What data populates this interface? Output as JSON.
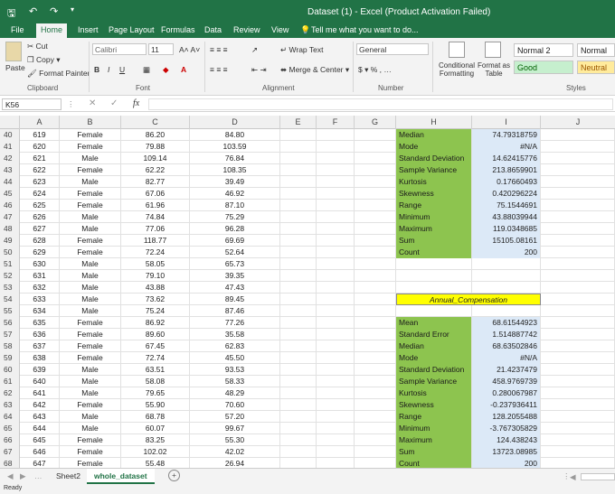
{
  "window": {
    "title": "Dataset (1) - Excel (Product Activation Failed)"
  },
  "tabs": [
    "File",
    "Home",
    "Insert",
    "Page Layout",
    "Formulas",
    "Data",
    "Review",
    "View"
  ],
  "tell_me": "Tell me what you want to do...",
  "clipboard": {
    "paste": "Paste",
    "cut": "Cut",
    "copy": "Copy",
    "format_painter": "Format Painter",
    "label": "Clipboard"
  },
  "font": {
    "name": "Calibri",
    "size": "11",
    "label": "Font"
  },
  "alignment": {
    "wrap": "Wrap Text",
    "merge": "Merge & Center",
    "label": "Alignment"
  },
  "number": {
    "format": "General",
    "label": "Number"
  },
  "styles": {
    "conditional": "Conditional Formatting",
    "format_table": "Format as Table",
    "normal2": "Normal 2",
    "normal": "Normal",
    "good": "Good",
    "neutral": "Neutral",
    "label": "Styles"
  },
  "formula_bar": {
    "namebox": "K56"
  },
  "columns": [
    "A",
    "B",
    "C",
    "D",
    "E",
    "F",
    "G",
    "H",
    "I",
    "J"
  ],
  "rows": [
    {
      "n": "40",
      "a": "619",
      "b": "Female",
      "c": "86.20",
      "d": "84.80",
      "h": "Median",
      "i": "74.79318759"
    },
    {
      "n": "41",
      "a": "620",
      "b": "Female",
      "c": "79.88",
      "d": "103.59",
      "h": "Mode",
      "i": "#N/A"
    },
    {
      "n": "42",
      "a": "621",
      "b": "Male",
      "c": "109.14",
      "d": "76.84",
      "h": "Standard Deviation",
      "i": "14.62415776"
    },
    {
      "n": "43",
      "a": "622",
      "b": "Female",
      "c": "62.22",
      "d": "108.35",
      "h": "Sample Variance",
      "i": "213.8659901"
    },
    {
      "n": "44",
      "a": "623",
      "b": "Male",
      "c": "82.77",
      "d": "39.49",
      "h": "Kurtosis",
      "i": "0.17660493"
    },
    {
      "n": "45",
      "a": "624",
      "b": "Female",
      "c": "67.06",
      "d": "46.92",
      "h": "Skewness",
      "i": "0.420296224"
    },
    {
      "n": "46",
      "a": "625",
      "b": "Female",
      "c": "61.96",
      "d": "87.10",
      "h": "Range",
      "i": "75.1544691"
    },
    {
      "n": "47",
      "a": "626",
      "b": "Male",
      "c": "74.84",
      "d": "75.29",
      "h": "Minimum",
      "i": "43.88039944"
    },
    {
      "n": "48",
      "a": "627",
      "b": "Male",
      "c": "77.06",
      "d": "96.28",
      "h": "Maximum",
      "i": "119.0348685"
    },
    {
      "n": "49",
      "a": "628",
      "b": "Female",
      "c": "118.77",
      "d": "69.69",
      "h": "Sum",
      "i": "15105.08161"
    },
    {
      "n": "50",
      "a": "629",
      "b": "Female",
      "c": "72.24",
      "d": "52.64",
      "h": "Count",
      "i": "200"
    },
    {
      "n": "51",
      "a": "630",
      "b": "Male",
      "c": "58.05",
      "d": "65.73",
      "h": "",
      "i": ""
    },
    {
      "n": "52",
      "a": "631",
      "b": "Male",
      "c": "79.10",
      "d": "39.35",
      "h": "",
      "i": ""
    },
    {
      "n": "53",
      "a": "632",
      "b": "Male",
      "c": "43.88",
      "d": "47.43",
      "h": "",
      "i": ""
    },
    {
      "n": "54",
      "a": "633",
      "b": "Male",
      "c": "73.62",
      "d": "89.45",
      "h": "Annual_Compensation",
      "i": ""
    },
    {
      "n": "55",
      "a": "634",
      "b": "Male",
      "c": "75.24",
      "d": "87.46",
      "h": "",
      "i": ""
    },
    {
      "n": "56",
      "a": "635",
      "b": "Female",
      "c": "86.92",
      "d": "77.26",
      "h": "Mean",
      "i": "68.61544923"
    },
    {
      "n": "57",
      "a": "636",
      "b": "Female",
      "c": "89.60",
      "d": "35.58",
      "h": "Standard Error",
      "i": "1.514887742"
    },
    {
      "n": "58",
      "a": "637",
      "b": "Female",
      "c": "67.45",
      "d": "62.83",
      "h": "Median",
      "i": "68.63502846"
    },
    {
      "n": "59",
      "a": "638",
      "b": "Female",
      "c": "72.74",
      "d": "45.50",
      "h": "Mode",
      "i": "#N/A"
    },
    {
      "n": "60",
      "a": "639",
      "b": "Male",
      "c": "63.51",
      "d": "93.53",
      "h": "Standard Deviation",
      "i": "21.4237479"
    },
    {
      "n": "61",
      "a": "640",
      "b": "Male",
      "c": "58.08",
      "d": "58.33",
      "h": "Sample Variance",
      "i": "458.9769739"
    },
    {
      "n": "62",
      "a": "641",
      "b": "Male",
      "c": "79.65",
      "d": "48.29",
      "h": "Kurtosis",
      "i": "0.280067987"
    },
    {
      "n": "63",
      "a": "642",
      "b": "Female",
      "c": "55.90",
      "d": "70.60",
      "h": "Skewness",
      "i": "-0.237936411"
    },
    {
      "n": "64",
      "a": "643",
      "b": "Male",
      "c": "68.78",
      "d": "57.20",
      "h": "Range",
      "i": "128.2055488"
    },
    {
      "n": "65",
      "a": "644",
      "b": "Male",
      "c": "60.07",
      "d": "99.67",
      "h": "Minimum",
      "i": "-3.767305829"
    },
    {
      "n": "66",
      "a": "645",
      "b": "Female",
      "c": "83.25",
      "d": "55.30",
      "h": "Maximum",
      "i": "124.438243"
    },
    {
      "n": "67",
      "a": "646",
      "b": "Female",
      "c": "102.02",
      "d": "42.02",
      "h": "Sum",
      "i": "13723.08985"
    },
    {
      "n": "68",
      "a": "647",
      "b": "Female",
      "c": "55.48",
      "d": "26.94",
      "h": "Count",
      "i": "200"
    }
  ],
  "sheets": [
    "Sheet2",
    "whole_dataset"
  ],
  "status": "Ready",
  "colors": {
    "excel_green": "#217346",
    "stat_green": "#8dc44f",
    "header_yellow": "#ffff00",
    "value_blue": "#dce9f7"
  }
}
